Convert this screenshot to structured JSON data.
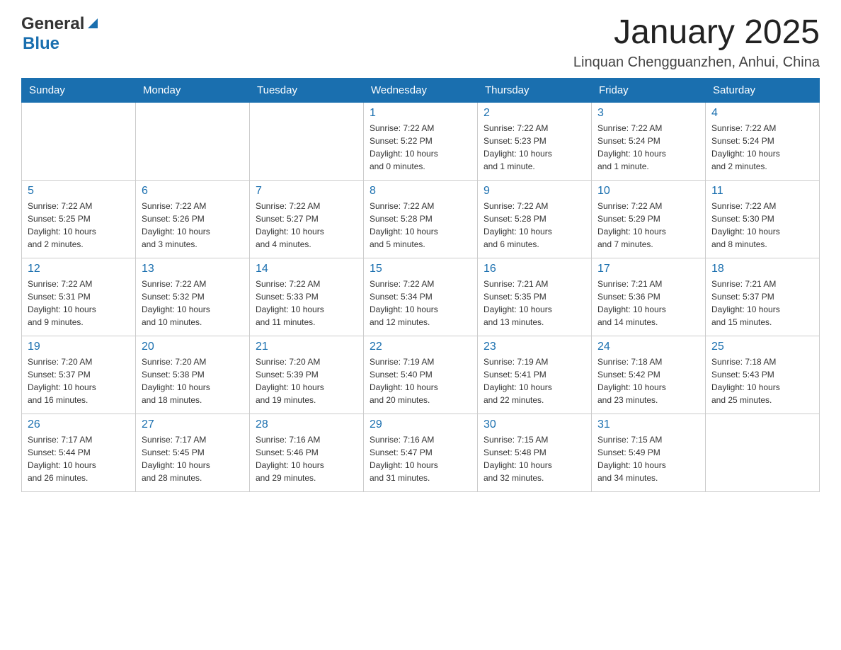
{
  "header": {
    "logo": {
      "text_general": "General",
      "text_blue": "Blue",
      "triangle_symbol": "▲"
    },
    "title": "January 2025",
    "location": "Linquan Chengguanzhen, Anhui, China"
  },
  "days_of_week": [
    "Sunday",
    "Monday",
    "Tuesday",
    "Wednesday",
    "Thursday",
    "Friday",
    "Saturday"
  ],
  "weeks": [
    {
      "days": [
        {
          "number": "",
          "info": ""
        },
        {
          "number": "",
          "info": ""
        },
        {
          "number": "",
          "info": ""
        },
        {
          "number": "1",
          "info": "Sunrise: 7:22 AM\nSunset: 5:22 PM\nDaylight: 10 hours\nand 0 minutes."
        },
        {
          "number": "2",
          "info": "Sunrise: 7:22 AM\nSunset: 5:23 PM\nDaylight: 10 hours\nand 1 minute."
        },
        {
          "number": "3",
          "info": "Sunrise: 7:22 AM\nSunset: 5:24 PM\nDaylight: 10 hours\nand 1 minute."
        },
        {
          "number": "4",
          "info": "Sunrise: 7:22 AM\nSunset: 5:24 PM\nDaylight: 10 hours\nand 2 minutes."
        }
      ]
    },
    {
      "days": [
        {
          "number": "5",
          "info": "Sunrise: 7:22 AM\nSunset: 5:25 PM\nDaylight: 10 hours\nand 2 minutes."
        },
        {
          "number": "6",
          "info": "Sunrise: 7:22 AM\nSunset: 5:26 PM\nDaylight: 10 hours\nand 3 minutes."
        },
        {
          "number": "7",
          "info": "Sunrise: 7:22 AM\nSunset: 5:27 PM\nDaylight: 10 hours\nand 4 minutes."
        },
        {
          "number": "8",
          "info": "Sunrise: 7:22 AM\nSunset: 5:28 PM\nDaylight: 10 hours\nand 5 minutes."
        },
        {
          "number": "9",
          "info": "Sunrise: 7:22 AM\nSunset: 5:28 PM\nDaylight: 10 hours\nand 6 minutes."
        },
        {
          "number": "10",
          "info": "Sunrise: 7:22 AM\nSunset: 5:29 PM\nDaylight: 10 hours\nand 7 minutes."
        },
        {
          "number": "11",
          "info": "Sunrise: 7:22 AM\nSunset: 5:30 PM\nDaylight: 10 hours\nand 8 minutes."
        }
      ]
    },
    {
      "days": [
        {
          "number": "12",
          "info": "Sunrise: 7:22 AM\nSunset: 5:31 PM\nDaylight: 10 hours\nand 9 minutes."
        },
        {
          "number": "13",
          "info": "Sunrise: 7:22 AM\nSunset: 5:32 PM\nDaylight: 10 hours\nand 10 minutes."
        },
        {
          "number": "14",
          "info": "Sunrise: 7:22 AM\nSunset: 5:33 PM\nDaylight: 10 hours\nand 11 minutes."
        },
        {
          "number": "15",
          "info": "Sunrise: 7:22 AM\nSunset: 5:34 PM\nDaylight: 10 hours\nand 12 minutes."
        },
        {
          "number": "16",
          "info": "Sunrise: 7:21 AM\nSunset: 5:35 PM\nDaylight: 10 hours\nand 13 minutes."
        },
        {
          "number": "17",
          "info": "Sunrise: 7:21 AM\nSunset: 5:36 PM\nDaylight: 10 hours\nand 14 minutes."
        },
        {
          "number": "18",
          "info": "Sunrise: 7:21 AM\nSunset: 5:37 PM\nDaylight: 10 hours\nand 15 minutes."
        }
      ]
    },
    {
      "days": [
        {
          "number": "19",
          "info": "Sunrise: 7:20 AM\nSunset: 5:37 PM\nDaylight: 10 hours\nand 16 minutes."
        },
        {
          "number": "20",
          "info": "Sunrise: 7:20 AM\nSunset: 5:38 PM\nDaylight: 10 hours\nand 18 minutes."
        },
        {
          "number": "21",
          "info": "Sunrise: 7:20 AM\nSunset: 5:39 PM\nDaylight: 10 hours\nand 19 minutes."
        },
        {
          "number": "22",
          "info": "Sunrise: 7:19 AM\nSunset: 5:40 PM\nDaylight: 10 hours\nand 20 minutes."
        },
        {
          "number": "23",
          "info": "Sunrise: 7:19 AM\nSunset: 5:41 PM\nDaylight: 10 hours\nand 22 minutes."
        },
        {
          "number": "24",
          "info": "Sunrise: 7:18 AM\nSunset: 5:42 PM\nDaylight: 10 hours\nand 23 minutes."
        },
        {
          "number": "25",
          "info": "Sunrise: 7:18 AM\nSunset: 5:43 PM\nDaylight: 10 hours\nand 25 minutes."
        }
      ]
    },
    {
      "days": [
        {
          "number": "26",
          "info": "Sunrise: 7:17 AM\nSunset: 5:44 PM\nDaylight: 10 hours\nand 26 minutes."
        },
        {
          "number": "27",
          "info": "Sunrise: 7:17 AM\nSunset: 5:45 PM\nDaylight: 10 hours\nand 28 minutes."
        },
        {
          "number": "28",
          "info": "Sunrise: 7:16 AM\nSunset: 5:46 PM\nDaylight: 10 hours\nand 29 minutes."
        },
        {
          "number": "29",
          "info": "Sunrise: 7:16 AM\nSunset: 5:47 PM\nDaylight: 10 hours\nand 31 minutes."
        },
        {
          "number": "30",
          "info": "Sunrise: 7:15 AM\nSunset: 5:48 PM\nDaylight: 10 hours\nand 32 minutes."
        },
        {
          "number": "31",
          "info": "Sunrise: 7:15 AM\nSunset: 5:49 PM\nDaylight: 10 hours\nand 34 minutes."
        },
        {
          "number": "",
          "info": ""
        }
      ]
    }
  ]
}
